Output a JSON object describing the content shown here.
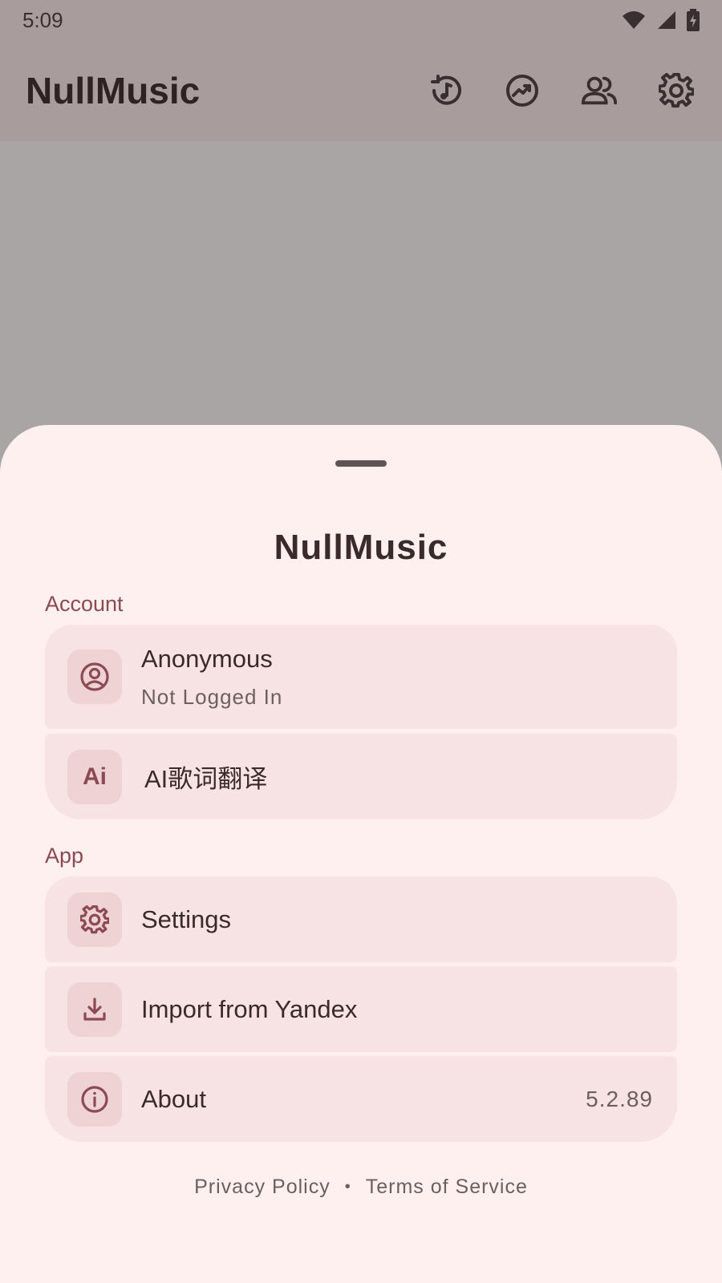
{
  "status_bar": {
    "time": "5:09"
  },
  "app_bar": {
    "title": "NullMusic"
  },
  "sheet": {
    "title": "NullMusic",
    "sections": {
      "account": {
        "label": "Account",
        "profile": {
          "name": "Anonymous",
          "status": "Not Logged In"
        },
        "ai": {
          "icon_text": "Ai",
          "label": "AI歌词翻译"
        }
      },
      "app": {
        "label": "App",
        "settings": {
          "label": "Settings"
        },
        "import": {
          "label": "Import from Yandex"
        },
        "about": {
          "label": "About",
          "version": "5.2.89"
        }
      }
    },
    "footer": {
      "privacy": "Privacy Policy",
      "separator": "•",
      "terms": "Terms of Service"
    }
  },
  "colors": {
    "accent": "#8c4a52",
    "sheet_bg": "#fdf0ef",
    "card_bg": "#f7e3e3",
    "icon_bg": "#efd3d4"
  }
}
